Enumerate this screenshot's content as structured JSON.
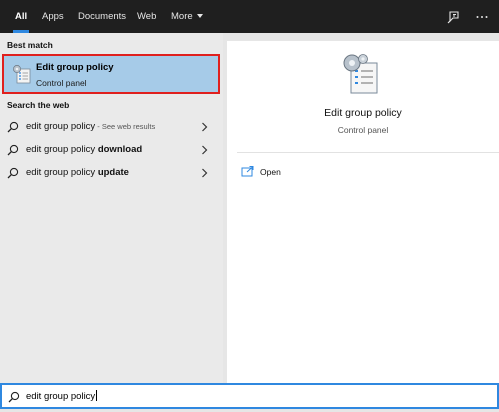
{
  "tabs": [
    {
      "label": "All",
      "active": true
    },
    {
      "label": "Apps"
    },
    {
      "label": "Documents"
    },
    {
      "label": "Web"
    },
    {
      "label": "More"
    }
  ],
  "top_icons": [
    "feedback-icon",
    "more-options-icon"
  ],
  "left": {
    "best_match_header": "Best match",
    "best_match": {
      "title": "Edit group policy",
      "subtitle": "Control panel",
      "icon": "group-policy-icon"
    },
    "web_header": "Search the web",
    "web_results": [
      {
        "prefix": "edit group policy",
        "bold": "",
        "suffix": " - See web results"
      },
      {
        "prefix": "edit group policy ",
        "bold": "download",
        "suffix": ""
      },
      {
        "prefix": "edit group policy ",
        "bold": "update",
        "suffix": ""
      }
    ]
  },
  "detail": {
    "title": "Edit group policy",
    "subtitle": "Control panel",
    "actions": [
      {
        "label": "Open",
        "icon": "open-icon"
      }
    ]
  },
  "search": {
    "value": "edit group policy",
    "icon": "search-icon"
  },
  "colors": {
    "accent": "#2f88e0",
    "highlight": "#a6cbe8",
    "outline": "#e0201e",
    "topbar": "#1f1f1f"
  }
}
